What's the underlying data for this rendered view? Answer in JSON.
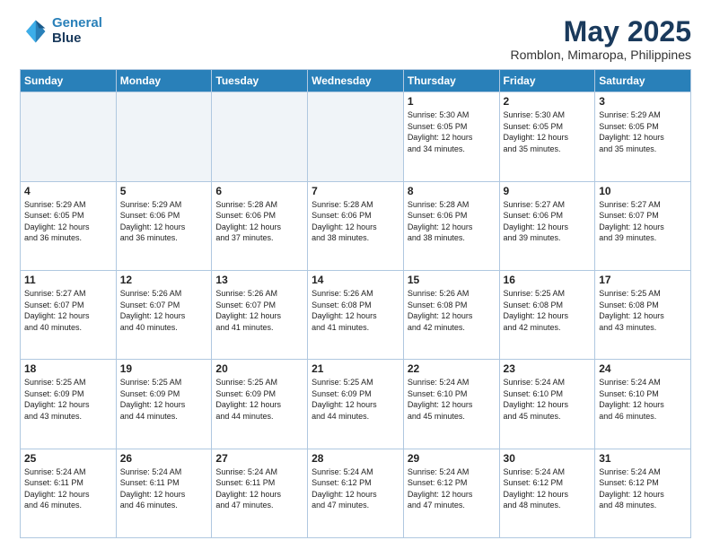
{
  "logo": {
    "line1": "General",
    "line2": "Blue"
  },
  "title": "May 2025",
  "subtitle": "Romblon, Mimaropa, Philippines",
  "weekdays": [
    "Sunday",
    "Monday",
    "Tuesday",
    "Wednesday",
    "Thursday",
    "Friday",
    "Saturday"
  ],
  "weeks": [
    [
      {
        "day": "",
        "info": ""
      },
      {
        "day": "",
        "info": ""
      },
      {
        "day": "",
        "info": ""
      },
      {
        "day": "",
        "info": ""
      },
      {
        "day": "1",
        "info": "Sunrise: 5:30 AM\nSunset: 6:05 PM\nDaylight: 12 hours\nand 34 minutes."
      },
      {
        "day": "2",
        "info": "Sunrise: 5:30 AM\nSunset: 6:05 PM\nDaylight: 12 hours\nand 35 minutes."
      },
      {
        "day": "3",
        "info": "Sunrise: 5:29 AM\nSunset: 6:05 PM\nDaylight: 12 hours\nand 35 minutes."
      }
    ],
    [
      {
        "day": "4",
        "info": "Sunrise: 5:29 AM\nSunset: 6:05 PM\nDaylight: 12 hours\nand 36 minutes."
      },
      {
        "day": "5",
        "info": "Sunrise: 5:29 AM\nSunset: 6:06 PM\nDaylight: 12 hours\nand 36 minutes."
      },
      {
        "day": "6",
        "info": "Sunrise: 5:28 AM\nSunset: 6:06 PM\nDaylight: 12 hours\nand 37 minutes."
      },
      {
        "day": "7",
        "info": "Sunrise: 5:28 AM\nSunset: 6:06 PM\nDaylight: 12 hours\nand 38 minutes."
      },
      {
        "day": "8",
        "info": "Sunrise: 5:28 AM\nSunset: 6:06 PM\nDaylight: 12 hours\nand 38 minutes."
      },
      {
        "day": "9",
        "info": "Sunrise: 5:27 AM\nSunset: 6:06 PM\nDaylight: 12 hours\nand 39 minutes."
      },
      {
        "day": "10",
        "info": "Sunrise: 5:27 AM\nSunset: 6:07 PM\nDaylight: 12 hours\nand 39 minutes."
      }
    ],
    [
      {
        "day": "11",
        "info": "Sunrise: 5:27 AM\nSunset: 6:07 PM\nDaylight: 12 hours\nand 40 minutes."
      },
      {
        "day": "12",
        "info": "Sunrise: 5:26 AM\nSunset: 6:07 PM\nDaylight: 12 hours\nand 40 minutes."
      },
      {
        "day": "13",
        "info": "Sunrise: 5:26 AM\nSunset: 6:07 PM\nDaylight: 12 hours\nand 41 minutes."
      },
      {
        "day": "14",
        "info": "Sunrise: 5:26 AM\nSunset: 6:08 PM\nDaylight: 12 hours\nand 41 minutes."
      },
      {
        "day": "15",
        "info": "Sunrise: 5:26 AM\nSunset: 6:08 PM\nDaylight: 12 hours\nand 42 minutes."
      },
      {
        "day": "16",
        "info": "Sunrise: 5:25 AM\nSunset: 6:08 PM\nDaylight: 12 hours\nand 42 minutes."
      },
      {
        "day": "17",
        "info": "Sunrise: 5:25 AM\nSunset: 6:08 PM\nDaylight: 12 hours\nand 43 minutes."
      }
    ],
    [
      {
        "day": "18",
        "info": "Sunrise: 5:25 AM\nSunset: 6:09 PM\nDaylight: 12 hours\nand 43 minutes."
      },
      {
        "day": "19",
        "info": "Sunrise: 5:25 AM\nSunset: 6:09 PM\nDaylight: 12 hours\nand 44 minutes."
      },
      {
        "day": "20",
        "info": "Sunrise: 5:25 AM\nSunset: 6:09 PM\nDaylight: 12 hours\nand 44 minutes."
      },
      {
        "day": "21",
        "info": "Sunrise: 5:25 AM\nSunset: 6:09 PM\nDaylight: 12 hours\nand 44 minutes."
      },
      {
        "day": "22",
        "info": "Sunrise: 5:24 AM\nSunset: 6:10 PM\nDaylight: 12 hours\nand 45 minutes."
      },
      {
        "day": "23",
        "info": "Sunrise: 5:24 AM\nSunset: 6:10 PM\nDaylight: 12 hours\nand 45 minutes."
      },
      {
        "day": "24",
        "info": "Sunrise: 5:24 AM\nSunset: 6:10 PM\nDaylight: 12 hours\nand 46 minutes."
      }
    ],
    [
      {
        "day": "25",
        "info": "Sunrise: 5:24 AM\nSunset: 6:11 PM\nDaylight: 12 hours\nand 46 minutes."
      },
      {
        "day": "26",
        "info": "Sunrise: 5:24 AM\nSunset: 6:11 PM\nDaylight: 12 hours\nand 46 minutes."
      },
      {
        "day": "27",
        "info": "Sunrise: 5:24 AM\nSunset: 6:11 PM\nDaylight: 12 hours\nand 47 minutes."
      },
      {
        "day": "28",
        "info": "Sunrise: 5:24 AM\nSunset: 6:12 PM\nDaylight: 12 hours\nand 47 minutes."
      },
      {
        "day": "29",
        "info": "Sunrise: 5:24 AM\nSunset: 6:12 PM\nDaylight: 12 hours\nand 47 minutes."
      },
      {
        "day": "30",
        "info": "Sunrise: 5:24 AM\nSunset: 6:12 PM\nDaylight: 12 hours\nand 48 minutes."
      },
      {
        "day": "31",
        "info": "Sunrise: 5:24 AM\nSunset: 6:12 PM\nDaylight: 12 hours\nand 48 minutes."
      }
    ]
  ]
}
